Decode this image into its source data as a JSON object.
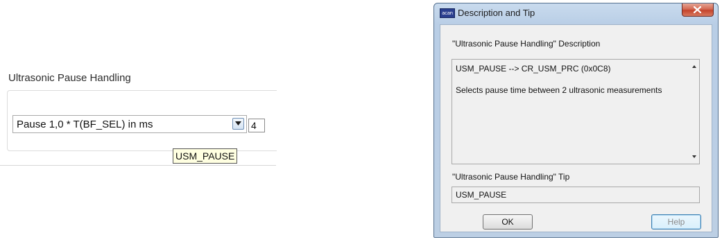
{
  "left_panel": {
    "section_title": "Ultrasonic Pause Handling",
    "combo_value": "Pause 1,0 * T(BF_SEL) in ms",
    "value_field": "4",
    "tooltip": "USM_PAUSE"
  },
  "dialog": {
    "title": "Description and Tip",
    "app_icon_text": "acan",
    "description_label": "\"Ultrasonic Pause Handling\" Description",
    "description_lines": [
      "USM_PAUSE --> CR_USM_PRC (0x0C8)",
      "Selects pause time between 2 ultrasonic measurements"
    ],
    "tip_label": "\"Ultrasonic Pause Handling\" Tip",
    "tip_value": "USM_PAUSE",
    "ok_label": "OK",
    "help_label": "Help"
  },
  "colors": {
    "dialog_frame": "#b9cee6",
    "close_button": "#c4442c",
    "tooltip_bg": "#ffffe1"
  }
}
